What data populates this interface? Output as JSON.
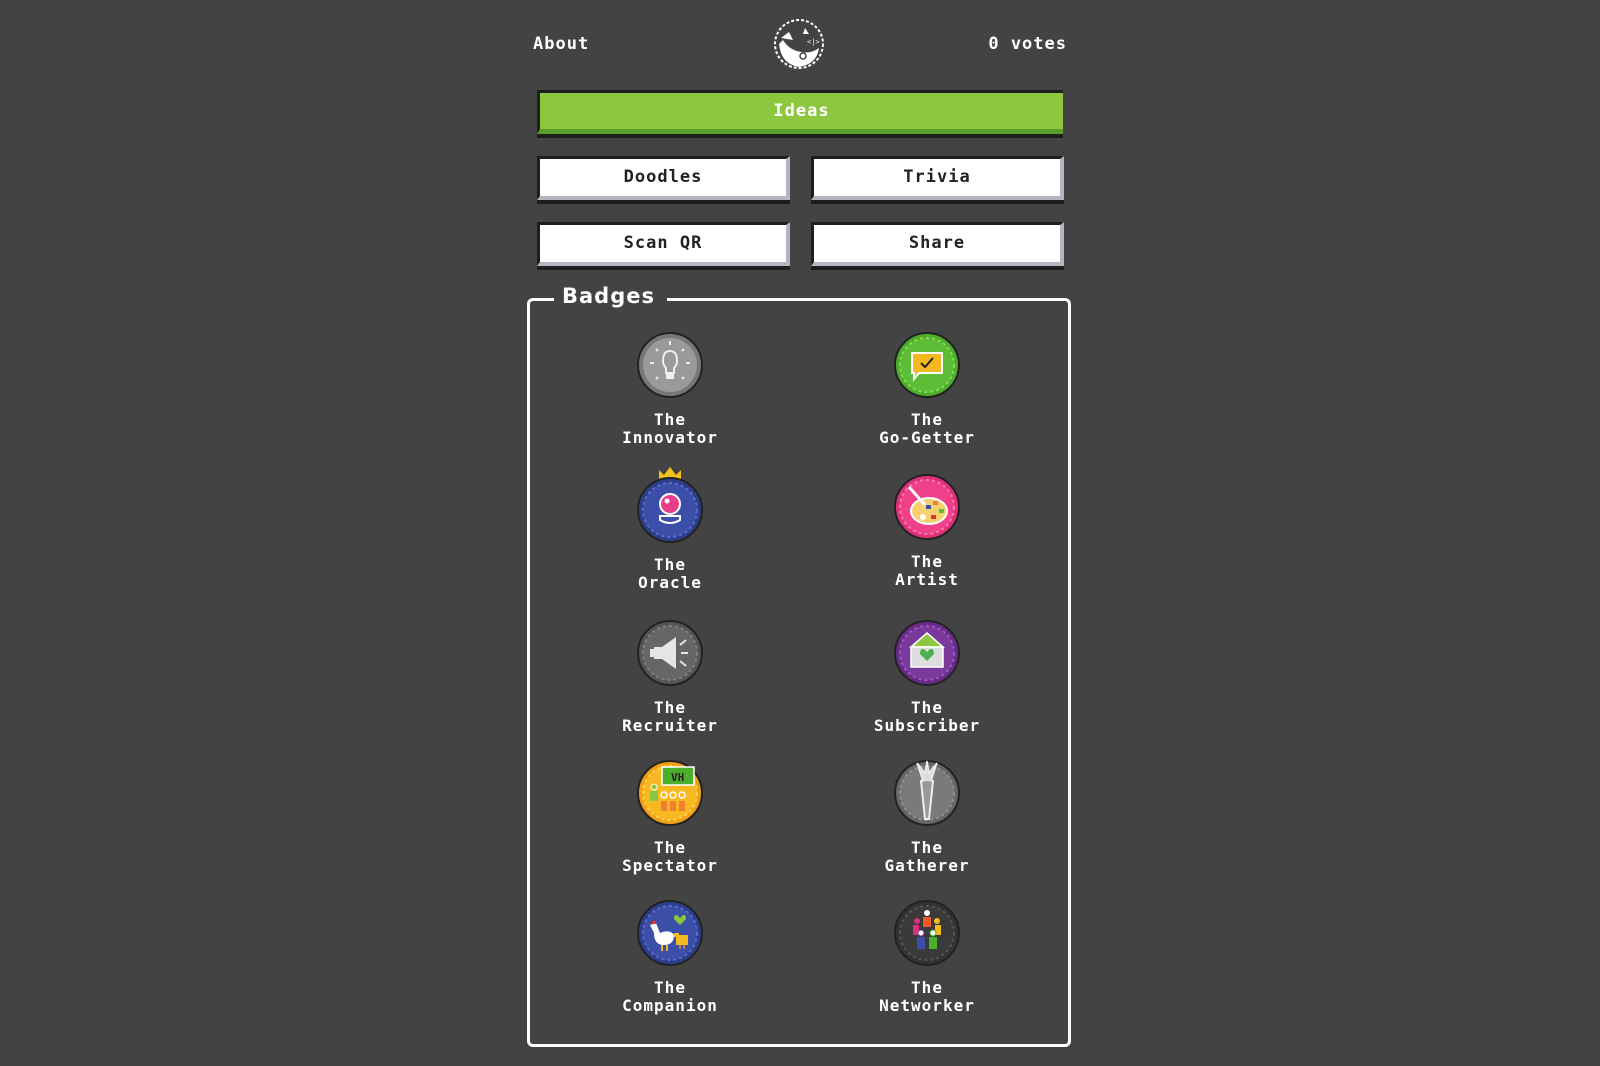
{
  "header": {
    "about_label": "About",
    "logo": "pig-logo-icon",
    "votes_label": "0 votes"
  },
  "nav": {
    "ideas_label": "Ideas",
    "doodles_label": "Doodles",
    "trivia_label": "Trivia",
    "scan_qr_label": "Scan QR",
    "share_label": "Share"
  },
  "badges": {
    "title": "Badges",
    "items": [
      {
        "line1": "The",
        "line2": "Innovator",
        "icon": "lightbulb-icon"
      },
      {
        "line1": "The",
        "line2": "Go-Getter",
        "icon": "chat-check-icon"
      },
      {
        "line1": "The",
        "line2": "Oracle",
        "icon": "crystal-ball-icon"
      },
      {
        "line1": "The",
        "line2": "Artist",
        "icon": "palette-icon"
      },
      {
        "line1": "The",
        "line2": "Recruiter",
        "icon": "megaphone-icon"
      },
      {
        "line1": "The",
        "line2": "Subscriber",
        "icon": "envelope-heart-icon"
      },
      {
        "line1": "The",
        "line2": "Spectator",
        "icon": "audience-screen-icon"
      },
      {
        "line1": "The",
        "line2": "Gatherer",
        "icon": "carrot-icon"
      },
      {
        "line1": "The",
        "line2": "Companion",
        "icon": "chicken-icon"
      },
      {
        "line1": "The",
        "line2": "Networker",
        "icon": "people-group-icon"
      }
    ]
  },
  "colors": {
    "background": "#434343",
    "accent_green": "#8dc63f"
  }
}
